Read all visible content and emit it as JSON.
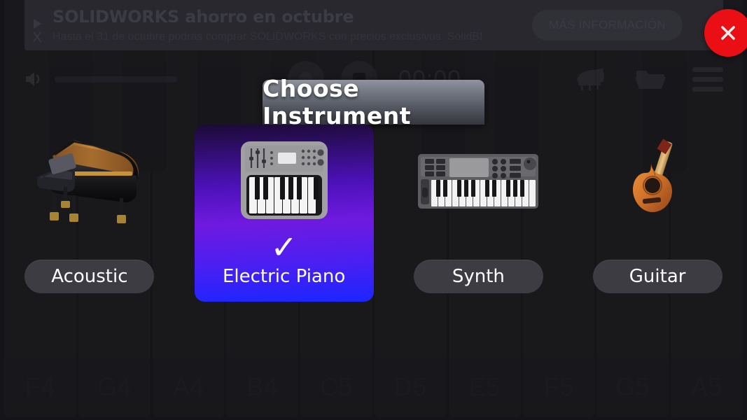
{
  "ad_banner": {
    "title": "SOLIDWORKS ahorro en octubre",
    "subtitle": "Hasta el 31 de octubre podrás comprar SOLIDWORKS con precios exclusivos. SolidBI",
    "cta_label": "MÁS INFORMACIÓN",
    "close_label": "✕",
    "play_marker": "",
    "x_marker": "X",
    "close_color": "#fb0f14"
  },
  "toolbar": {
    "volume_icon": "speaker-icon",
    "timer": "00:00",
    "record_icon": "record-icon",
    "stop_icon": "stop-icon",
    "piano_icon": "grand-piano-icon",
    "folder_icon": "folder-icon",
    "menu_icon": "hamburger-menu-icon"
  },
  "dialog": {
    "title": "Choose Instrument",
    "selected_index": 1,
    "check_glyph": "✓",
    "selected_gradient_from": "#6f1ae0",
    "selected_gradient_to": "#1b26ff",
    "instruments": [
      {
        "label": "Acoustic",
        "art": "grand-piano-art",
        "selected": false
      },
      {
        "label": "Electric Piano",
        "art": "electric-piano-art",
        "selected": true
      },
      {
        "label": "Synth",
        "art": "synth-keyboard-art",
        "selected": false
      },
      {
        "label": "Guitar",
        "art": "acoustic-guitar-art",
        "selected": false
      }
    ]
  },
  "keyboard": {
    "white_keys": [
      "F4",
      "G4",
      "A4",
      "B4",
      "C5",
      "D5",
      "E5",
      "F5",
      "G5",
      "A5"
    ],
    "black_key_positions": [
      70,
      175,
      282,
      388,
      602,
      708,
      918
    ]
  }
}
